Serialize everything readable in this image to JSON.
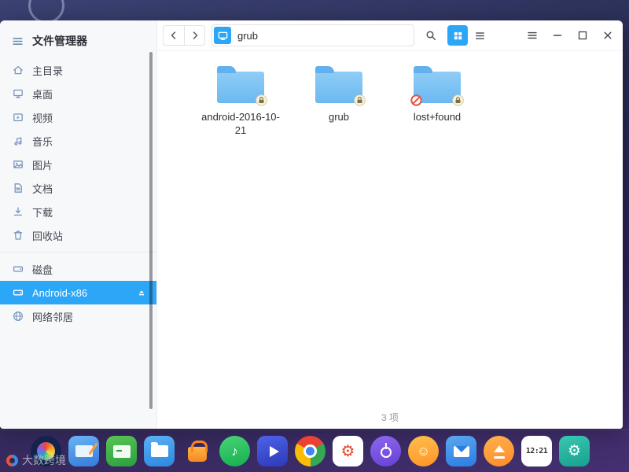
{
  "window": {
    "sidebar": {
      "title": "文件管理器",
      "items": [
        {
          "label": "主目录",
          "icon": "home-icon"
        },
        {
          "label": "桌面",
          "icon": "desktop-icon"
        },
        {
          "label": "视频",
          "icon": "videos-icon"
        },
        {
          "label": "音乐",
          "icon": "music-icon"
        },
        {
          "label": "图片",
          "icon": "pictures-icon"
        },
        {
          "label": "文档",
          "icon": "documents-icon"
        },
        {
          "label": "下载",
          "icon": "downloads-icon"
        },
        {
          "label": "回收站",
          "icon": "trash-icon"
        }
      ],
      "devices": [
        {
          "label": "磁盘",
          "icon": "disk-icon",
          "selected": false
        },
        {
          "label": "Android-x86",
          "icon": "disk-icon",
          "selected": true,
          "ejectable": true
        },
        {
          "label": "网络邻居",
          "icon": "network-icon",
          "selected": false
        }
      ]
    },
    "toolbar": {
      "path": "grub",
      "view_mode": "grid"
    },
    "files": [
      {
        "name": "android-2016-10-21",
        "type": "folder",
        "badges": [
          "lock"
        ]
      },
      {
        "name": "grub",
        "type": "folder",
        "badges": [
          "lock"
        ]
      },
      {
        "name": "lost+found",
        "type": "folder",
        "badges": [
          "no-access",
          "lock"
        ]
      }
    ],
    "statusbar": {
      "count_label": "3 项"
    }
  },
  "dock": {
    "clock": "12:21",
    "items": [
      {
        "name": "launcher"
      },
      {
        "name": "screen-capture"
      },
      {
        "name": "terminal"
      },
      {
        "name": "file-manager"
      },
      {
        "name": "app-store"
      },
      {
        "name": "music",
        "glyph": "♪"
      },
      {
        "name": "movies"
      },
      {
        "name": "browser"
      },
      {
        "name": "control-center",
        "glyph": "⚙"
      },
      {
        "name": "shutdown"
      },
      {
        "name": "support",
        "glyph": "☺"
      },
      {
        "name": "mail"
      },
      {
        "name": "boot-maker"
      },
      {
        "name": "clock"
      },
      {
        "name": "toolbox",
        "glyph": "⚙"
      }
    ]
  },
  "desktop": {
    "watermark": "大数跨境"
  },
  "colors": {
    "accent": "#2ca7f8",
    "folder_blue": "#74bdf0",
    "selection_text": "#ffffff"
  }
}
